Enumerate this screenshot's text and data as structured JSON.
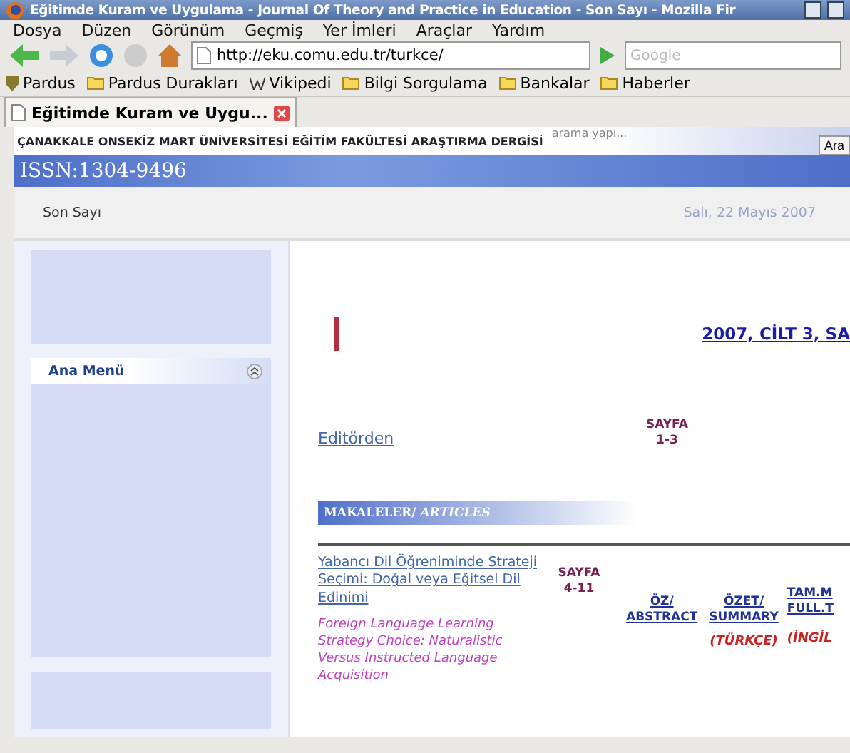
{
  "window": {
    "title": "Eğitimde Kuram ve Uygulama - Journal Of Theory and Practice in Education - Son Sayı - Mozilla Fir"
  },
  "menu": [
    "Dosya",
    "Düzen",
    "Görünüm",
    "Geçmiş",
    "Yer İmleri",
    "Araçlar",
    "Yardım"
  ],
  "toolbar": {
    "url": "http://eku.comu.edu.tr/turkce/",
    "search_placeholder": "Google"
  },
  "bookmarks": [
    {
      "label": "Pardus",
      "kind": "logo"
    },
    {
      "label": "Pardus Durakları",
      "kind": "folder"
    },
    {
      "label": "Vikipedi",
      "kind": "wiki"
    },
    {
      "label": "Bilgi Sorgulama",
      "kind": "folder"
    },
    {
      "label": "Bankalar",
      "kind": "folder"
    },
    {
      "label": "Haberler",
      "kind": "folder"
    }
  ],
  "tabs": [
    {
      "label": "Eğitimde Kuram ve Uygu...",
      "selected": true
    }
  ],
  "header": {
    "university": "ÇANAKKALE ONSEKİZ MART ÜNİVERSİTESİ EĞİTİM FAKÜLTESİ ARAŞTIRMA DERGİSİ",
    "search_hint": "arama yapı...",
    "search_button": "Ara",
    "issn": "ISSN:1304-9496"
  },
  "nav": {
    "item": "Son Sayı",
    "date": "Salı, 22 Mayıs 2007"
  },
  "sidebar": {
    "menu_title": "Ana Menü",
    "expanded": true
  },
  "main": {
    "issue_title": "2007, CİLT 3, SA",
    "editorial": {
      "title": "Editörden",
      "page_label": "SAYFA",
      "pages": "1-3"
    },
    "section": "MAKALELER/ *ARTICLES*",
    "articles": [
      {
        "title": "Yabancı Dil Öğreniminde Strateji Seçimi: Doğal veya Eğitsel Dil Edinimi",
        "title_en": "Foreign Language Learning Strategy Choice: Naturalistic Versus Instructed Language Acquisition",
        "page_label": "SAYFA",
        "pages": "4-11",
        "abstract": [
          "ÖZ/",
          "ABSTRACT"
        ],
        "summary": [
          "ÖZET/",
          "SUMMARY"
        ],
        "summary_lang": "(TÜRKÇE)",
        "fulltext": [
          "TAM.M",
          "FULL.T"
        ],
        "fulltext_lang": "(İNGİL"
      }
    ]
  }
}
